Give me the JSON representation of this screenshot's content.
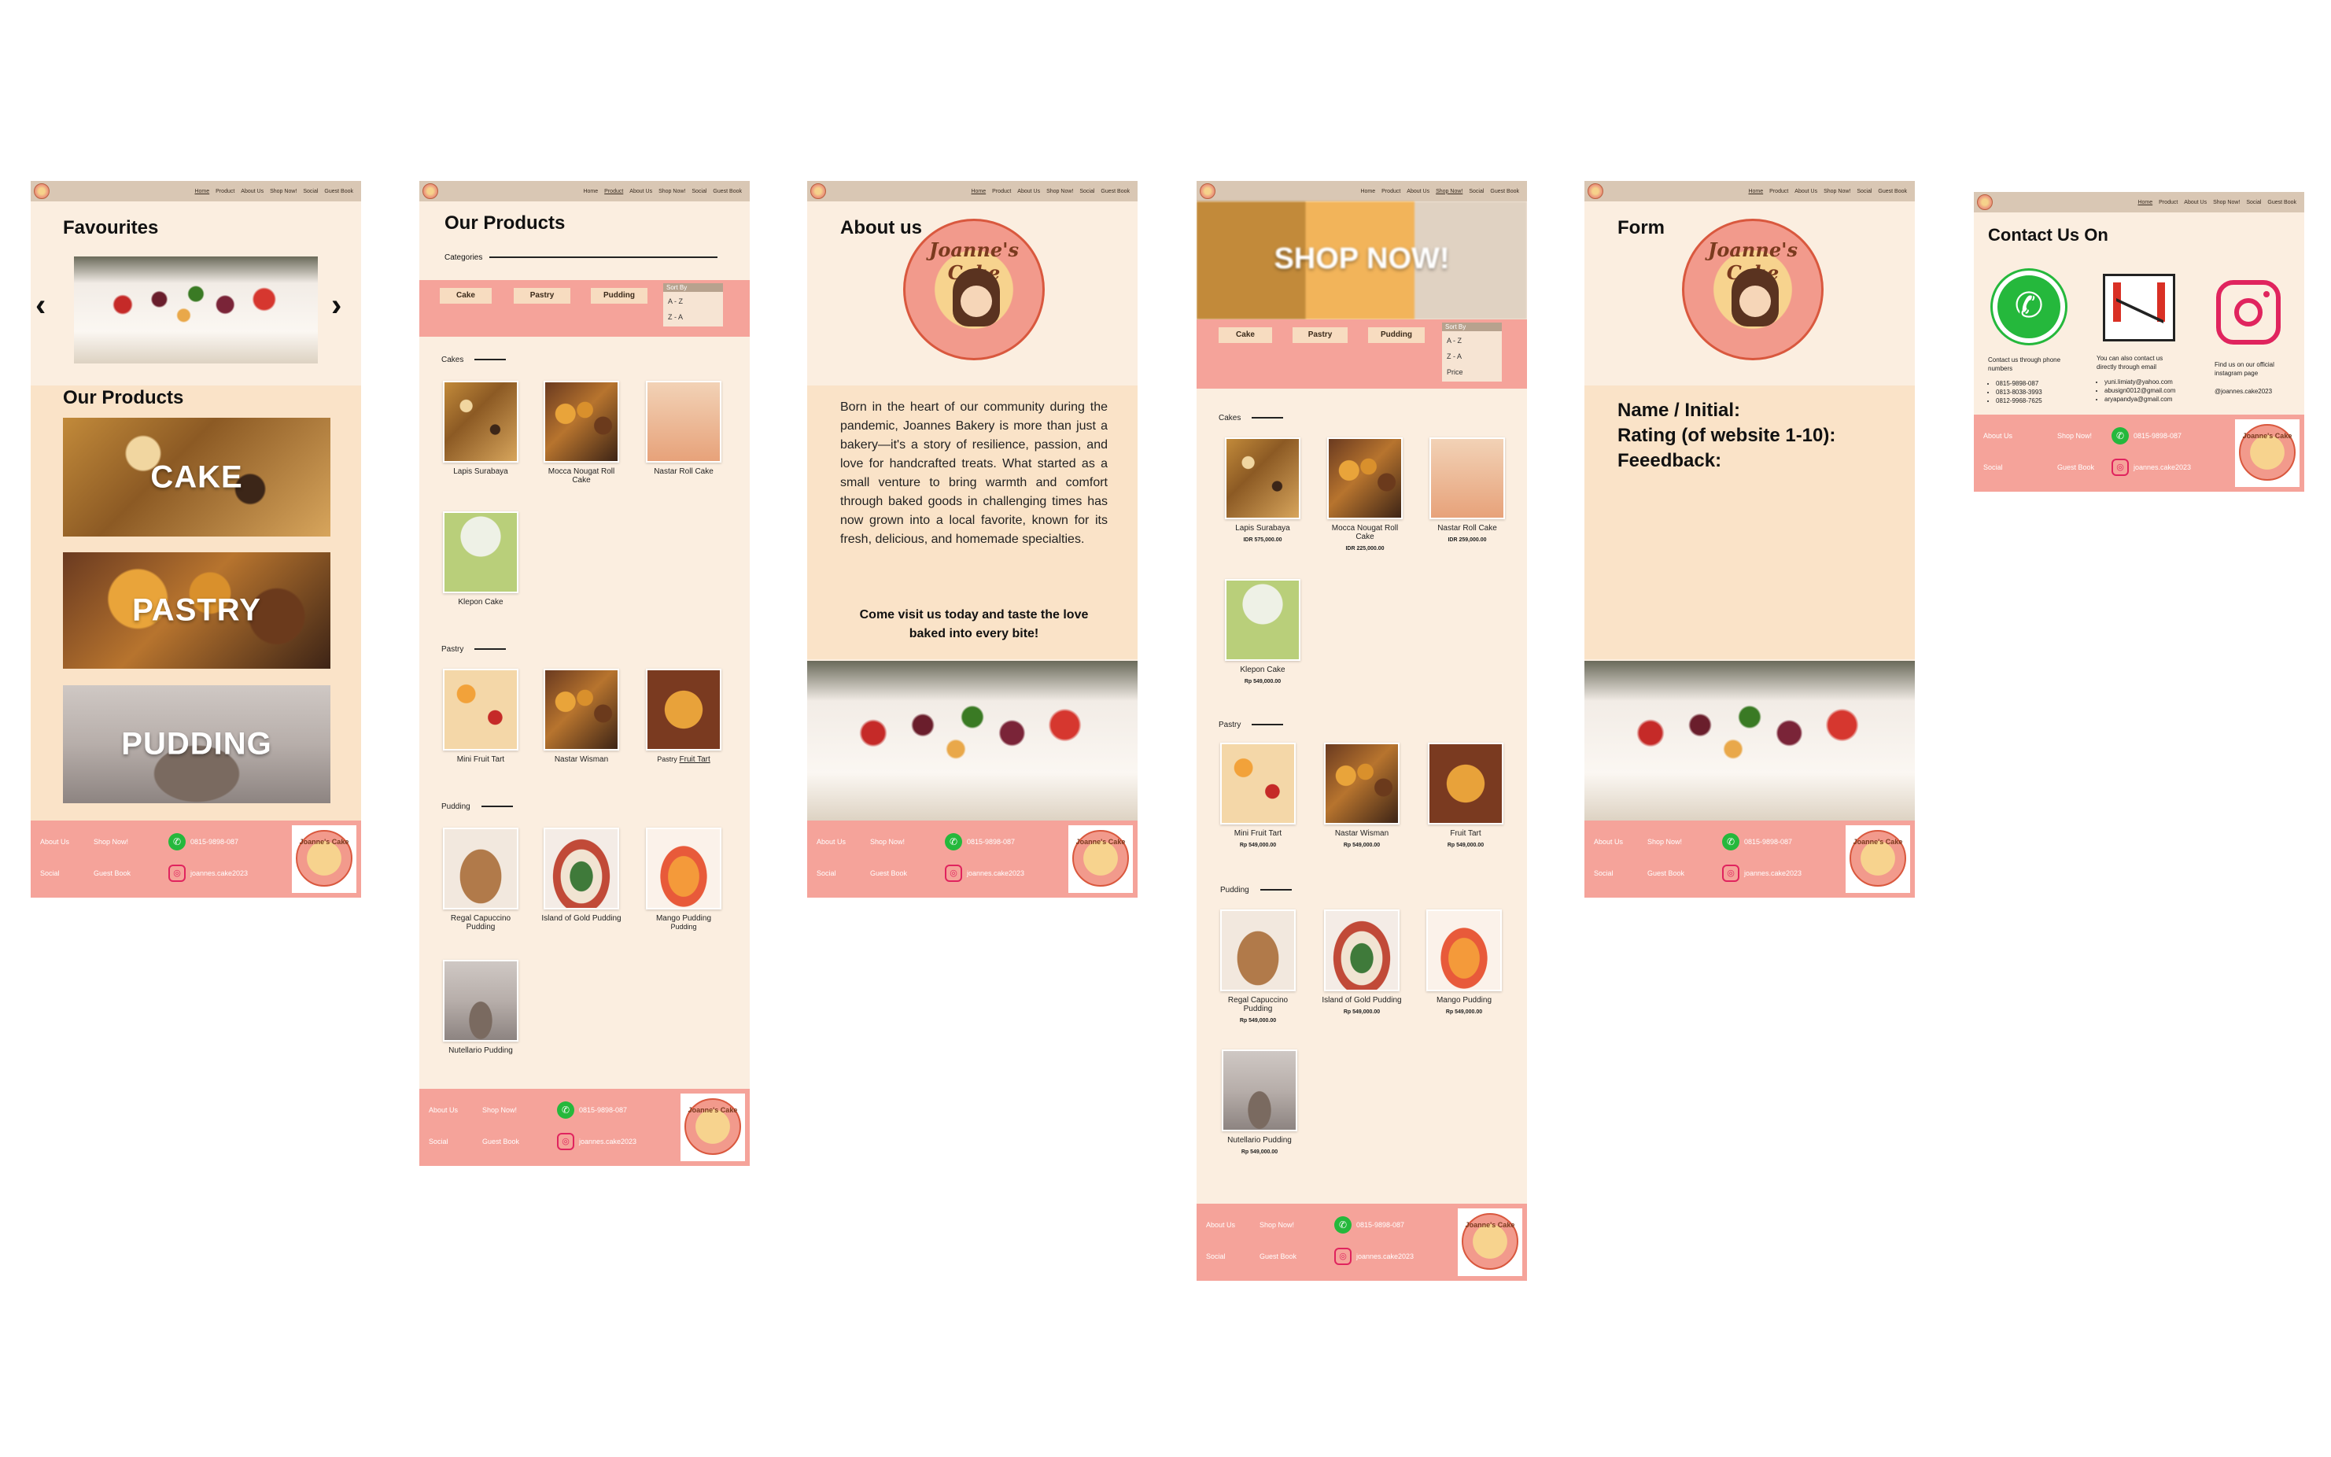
{
  "nav": {
    "items": [
      "Home",
      "Product",
      "About Us",
      "Shop Now!",
      "Social",
      "Guest Book"
    ]
  },
  "home": {
    "favourites_title": "Favourites",
    "products_title": "Our Products",
    "tiles": [
      "CAKE",
      "PASTRY",
      "PUDDING"
    ]
  },
  "footer": {
    "about_us": "About Us",
    "shop_now": "Shop Now!",
    "social": "Social",
    "guest_book": "Guest Book",
    "phone": "0815-9898-087",
    "instagram": "joannes.cake2023",
    "badge_text": "Joanne's Cake"
  },
  "products": {
    "title": "Our Products",
    "categories_label": "Categories",
    "buttons": [
      "Cake",
      "Pastry",
      "Pudding"
    ],
    "sort_by": "Sort By",
    "sort_options": [
      "A - Z",
      "Z - A"
    ],
    "sections": [
      "Cakes",
      "Pastry",
      "Pudding"
    ],
    "cakes": [
      "Lapis Surabaya",
      "Mocca Nougat Roll Cake",
      "Nastar Roll Cake",
      "Klepon Cake"
    ],
    "pastry": [
      "Mini Fruit Tart",
      "Nastar Wisman",
      "Fruit Tart"
    ],
    "pastry_prefix": "Pastry",
    "pudding": [
      "Regal Capuccino Pudding",
      "Island of Gold Pudding",
      "Mango Pudding",
      "Nutellario Pudding"
    ],
    "pudding_prefix": "Pudding"
  },
  "about": {
    "title": "About us",
    "logo_text": "Joanne's Cake",
    "body": "Born in the heart of our community during the pandemic, Joannes Bakery is more than just a bakery—it's a story of resilience, passion, and love for handcrafted treats. What started as a small venture to bring warmth and comfort through baked goods in challenging times has now grown into a local favorite, known for its fresh, delicious, and homemade specialties.",
    "cta": "Come visit us today and taste the love baked into every bite!"
  },
  "shop": {
    "banner": "SHOP NOW!",
    "buttons": [
      "Cake",
      "Pastry",
      "Pudding"
    ],
    "sort_by": "Sort By",
    "sort_options": [
      "A - Z",
      "Z - A",
      "Price"
    ],
    "sections": [
      "Cakes",
      "Pastry",
      "Pudding"
    ],
    "cakes": [
      {
        "name": "Lapis Surabaya",
        "price": "IDR 575,000.00"
      },
      {
        "name": "Mocca Nougat Roll Cake",
        "price": "IDR 225,000.00"
      },
      {
        "name": "Nastar Roll Cake",
        "price": "IDR 259,000.00"
      },
      {
        "name": "Klepon Cake",
        "price": "Rp 549,000.00"
      }
    ],
    "pastry": [
      {
        "name": "Mini Fruit Tart",
        "price": "Rp 549,000.00"
      },
      {
        "name": "Nastar Wisman",
        "price": "Rp 549,000.00"
      },
      {
        "name": "Fruit Tart",
        "price": "Rp 549,000.00"
      }
    ],
    "pudding": [
      {
        "name": "Regal Capuccino Pudding",
        "price": "Rp 549,000.00"
      },
      {
        "name": "Island of Gold Pudding",
        "price": "Rp 549,000.00"
      },
      {
        "name": "Mango Pudding",
        "price": "Rp 549,000.00"
      },
      {
        "name": "Nutellario Pudding",
        "price": "Rp 549,000.00"
      }
    ]
  },
  "form": {
    "title": "Form",
    "fields": [
      "Name / Initial:",
      "Rating (of website 1-10):",
      "Feeedback:"
    ]
  },
  "contact": {
    "title": "Contact Us On",
    "phone_caption": "Contact us through phone numbers",
    "phones": [
      "0815-9898-087",
      "0813-8038-3993",
      "0812-9968-7625"
    ],
    "email_caption": "You can also contact us directly through email",
    "emails": [
      "yuni.limiaty@yahoo.com",
      "abusign0012@gmail.com",
      "aryapandya@gmail.com"
    ],
    "ig_caption": "Find us on our official instagram page",
    "ig_handle": "@joannes.cake2023"
  },
  "colors": {
    "cream": "#fbeee0",
    "peach": "#fae3c8",
    "salmon": "#f5a39a",
    "nav": "#d9c7b4"
  }
}
